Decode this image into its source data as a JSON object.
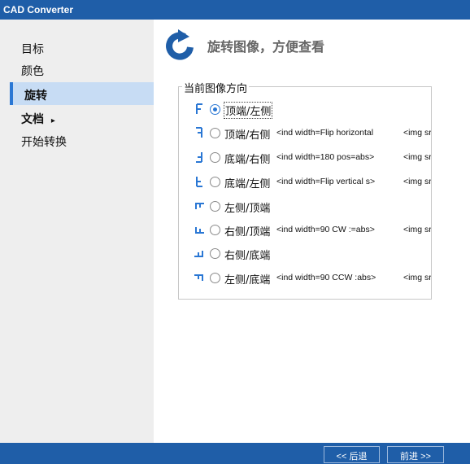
{
  "window": {
    "title": "CAD Converter"
  },
  "sidebar": {
    "items": [
      {
        "label": "目标"
      },
      {
        "label": "颜色"
      },
      {
        "label": "旋转"
      },
      {
        "label": "文档",
        "arrow": "▸"
      },
      {
        "label": "开始转换"
      }
    ]
  },
  "header": {
    "title": "旋转图像，方便查看",
    "icon": "rotate-counterclockwise-icon"
  },
  "orientation_group": {
    "legend": "当前图像方向",
    "options": [
      {
        "label": "顶端/左侧",
        "checked": true,
        "extra": "",
        "extra2": ""
      },
      {
        "label": "顶端/右侧",
        "checked": false,
        "extra": "<ind width=Flip horizontal",
        "extra2": "<img src"
      },
      {
        "label": "底端/右侧",
        "checked": false,
        "extra": "<ind width=180 pos=abs>",
        "extra2": "<img src"
      },
      {
        "label": "底端/左侧",
        "checked": false,
        "extra": "<ind width=Flip vertical s>",
        "extra2": "<img src"
      },
      {
        "label": "左侧/顶端",
        "checked": false,
        "extra": "",
        "extra2": ""
      },
      {
        "label": "右侧/顶端",
        "checked": false,
        "extra": "<ind width=90 CW :=abs>",
        "extra2": "<img src"
      },
      {
        "label": "右侧/底端",
        "checked": false,
        "extra": "",
        "extra2": ""
      },
      {
        "label": "左侧/底端",
        "checked": false,
        "extra": "<ind width=90 CCW :abs>",
        "extra2": "<img src"
      }
    ]
  },
  "footer": {
    "back_label": "<< 后退",
    "next_label": "前进 >>"
  },
  "colors": {
    "accent": "#1f5ea8",
    "selected_bg": "#c7dcf4",
    "sidebar_bg": "#eeeeee",
    "icon_blue": "#2a77d4"
  }
}
